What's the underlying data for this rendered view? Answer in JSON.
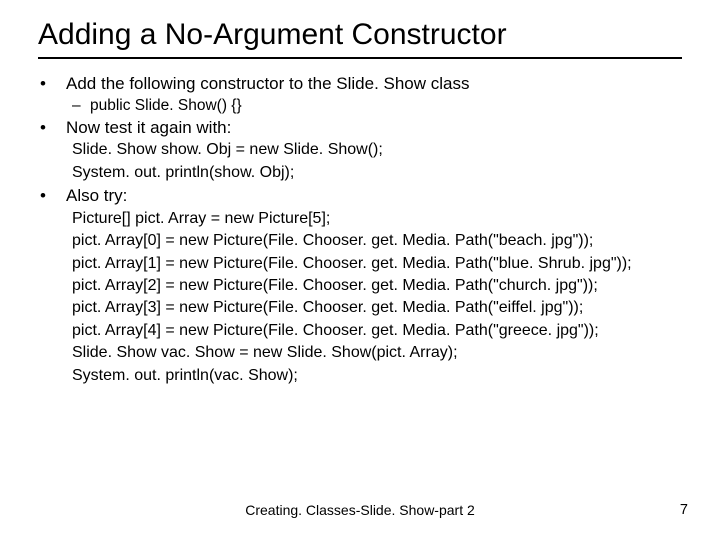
{
  "title": "Adding a No-Argument Constructor",
  "bullets": {
    "b1": "Add the following constructor to the Slide. Show class",
    "b1_sub": "public Slide. Show() {}",
    "b2": "Now test it again with:",
    "b2_code1": "Slide. Show show. Obj = new Slide. Show();",
    "b2_code2": "System. out. println(show. Obj);",
    "b3": "Also try:",
    "b3_code1": "Picture[] pict. Array = new Picture[5];",
    "b3_code2": "pict. Array[0] = new Picture(File. Chooser. get. Media. Path(\"beach. jpg\"));",
    "b3_code3": "pict. Array[1] = new Picture(File. Chooser. get. Media. Path(\"blue. Shrub. jpg\"));",
    "b3_code4": "pict. Array[2] = new Picture(File. Chooser. get. Media. Path(\"church. jpg\"));",
    "b3_code5": "pict. Array[3] = new Picture(File. Chooser. get. Media. Path(\"eiffel. jpg\"));",
    "b3_code6": "pict. Array[4] = new Picture(File. Chooser. get. Media. Path(\"greece. jpg\"));",
    "b3_code7": "Slide. Show vac. Show = new Slide. Show(pict. Array);",
    "b3_code8": "System. out. println(vac. Show);"
  },
  "footer": {
    "center": "Creating. Classes-Slide. Show-part 2",
    "page": "7"
  }
}
